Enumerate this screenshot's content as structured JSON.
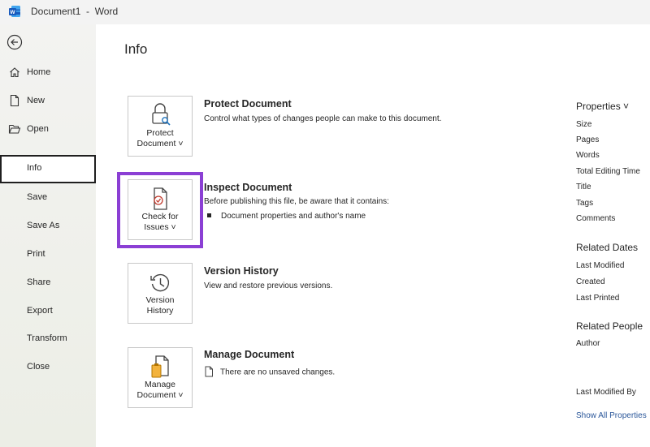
{
  "window": {
    "title": "Document1  -  Word"
  },
  "sidebar": {
    "items": [
      {
        "label": "Home"
      },
      {
        "label": "New"
      },
      {
        "label": "Open"
      },
      {
        "label": "Info"
      },
      {
        "label": "Save"
      },
      {
        "label": "Save As"
      },
      {
        "label": "Print"
      },
      {
        "label": "Share"
      },
      {
        "label": "Export"
      },
      {
        "label": "Transform"
      },
      {
        "label": "Close"
      }
    ]
  },
  "main": {
    "title": "Info",
    "sections": [
      {
        "button_line1": "Protect",
        "button_line2": "Document ˅",
        "title": "Protect Document",
        "description": "Control what types of changes people can make to this document."
      },
      {
        "button_line1": "Check for",
        "button_line2": "Issues ˅",
        "title": "Inspect Document",
        "description": "Before publishing this file, be aware that it contains:",
        "bullet": "Document properties and author's name"
      },
      {
        "button_line1": "Version",
        "button_line2": "History",
        "title": "Version History",
        "description": "View and restore previous versions."
      },
      {
        "button_line1": "Manage",
        "button_line2": "Document ˅",
        "title": "Manage Document",
        "description": "There are no unsaved changes."
      }
    ]
  },
  "properties": {
    "header": "Properties ˅",
    "fields": [
      "Size",
      "Pages",
      "Words",
      "Total Editing Time",
      "Title",
      "Tags",
      "Comments"
    ],
    "related_dates_header": "Related Dates",
    "dates": [
      "Last Modified",
      "Created",
      "Last Printed"
    ],
    "related_people_header": "Related People",
    "people": [
      "Author"
    ],
    "last_modified_by": "Last Modified By",
    "show_all": "Show All Properties"
  },
  "colors": {
    "accent": "#2b579a",
    "highlight": "#8b3fd4"
  }
}
